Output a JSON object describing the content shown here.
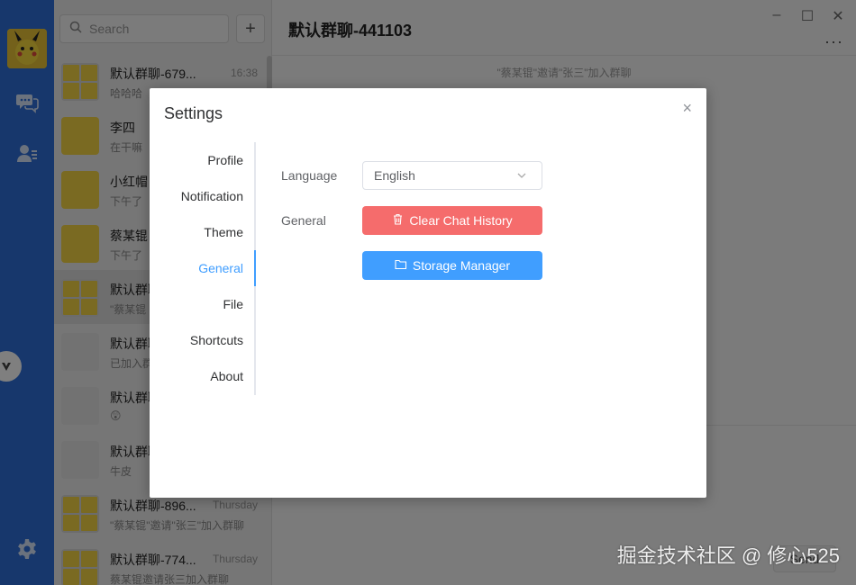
{
  "app": {
    "search_placeholder": "Search",
    "add_label": "+",
    "chat_title": "默认群聊-441103",
    "system_message": "\"蔡某锟\"邀请\"张三\"加入群聊",
    "send_label": "Send",
    "more_label": "···"
  },
  "chats": [
    {
      "name": "默认群聊-679...",
      "time": "16:38",
      "msg": "哈哈哈"
    },
    {
      "name": "李四",
      "time": "",
      "msg": "在干嘛"
    },
    {
      "name": "小红帽",
      "time": "",
      "msg": "下午了"
    },
    {
      "name": "蔡某锟",
      "time": "",
      "msg": "下午了"
    },
    {
      "name": "默认群聊",
      "time": "",
      "msg": "\"蔡某锟"
    },
    {
      "name": "默认群聊",
      "time": "",
      "msg": "已加入群"
    },
    {
      "name": "默认群聊",
      "time": "",
      "msg": "😲"
    },
    {
      "name": "默认群聊",
      "time": "",
      "msg": "牛皮"
    },
    {
      "name": "默认群聊-896...",
      "time": "Thursday",
      "msg": "\"蔡某锟\"邀请\"张三\"加入群聊"
    },
    {
      "name": "默认群聊-774...",
      "time": "Thursday",
      "msg": "蔡某锟邀请张三加入群聊"
    }
  ],
  "settings": {
    "title": "Settings",
    "close_label": "×",
    "tabs": [
      "Profile",
      "Notification",
      "Theme",
      "General",
      "File",
      "Shortcuts",
      "About"
    ],
    "active_tab": "General",
    "language_label": "Language",
    "language_value": "English",
    "general_label": "General",
    "clear_history_label": "Clear Chat History",
    "storage_manager_label": "Storage Manager"
  },
  "colors": {
    "rail": "#2e6fd8",
    "accent": "#409eff",
    "danger": "#f56c6c"
  },
  "watermark": "掘金技术社区 @ 修心525"
}
